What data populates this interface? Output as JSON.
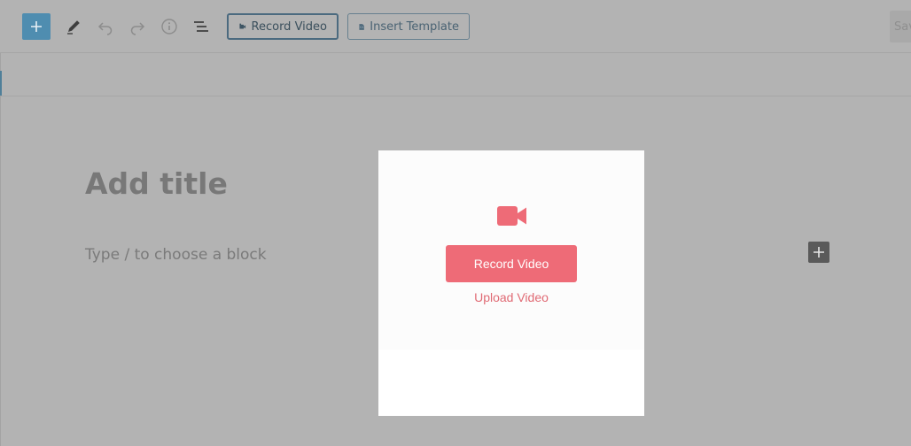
{
  "toolbar": {
    "add_block_icon": "plus-icon",
    "tools": [
      "pencil-icon",
      "undo-icon",
      "redo-icon",
      "info-icon",
      "list-view-icon"
    ],
    "record_video_label": "Record Video",
    "record_video_icon": "video-camera-icon",
    "insert_template_label": "Insert Template",
    "insert_template_icon": "code-document-icon",
    "save_label": "Save"
  },
  "editor": {
    "title_placeholder": "Add title",
    "block_placeholder": "Type / to choose a block",
    "block_add_icon": "plus-icon"
  },
  "modal": {
    "icon": "video-camera-icon",
    "record_label": "Record Video",
    "upload_label": "Upload Video",
    "accent_color": "#ee6b77"
  },
  "colors": {
    "overlay": "#b3b3b3",
    "primary_blue": "#4f8db0",
    "modal_bg": "#ffffff"
  }
}
